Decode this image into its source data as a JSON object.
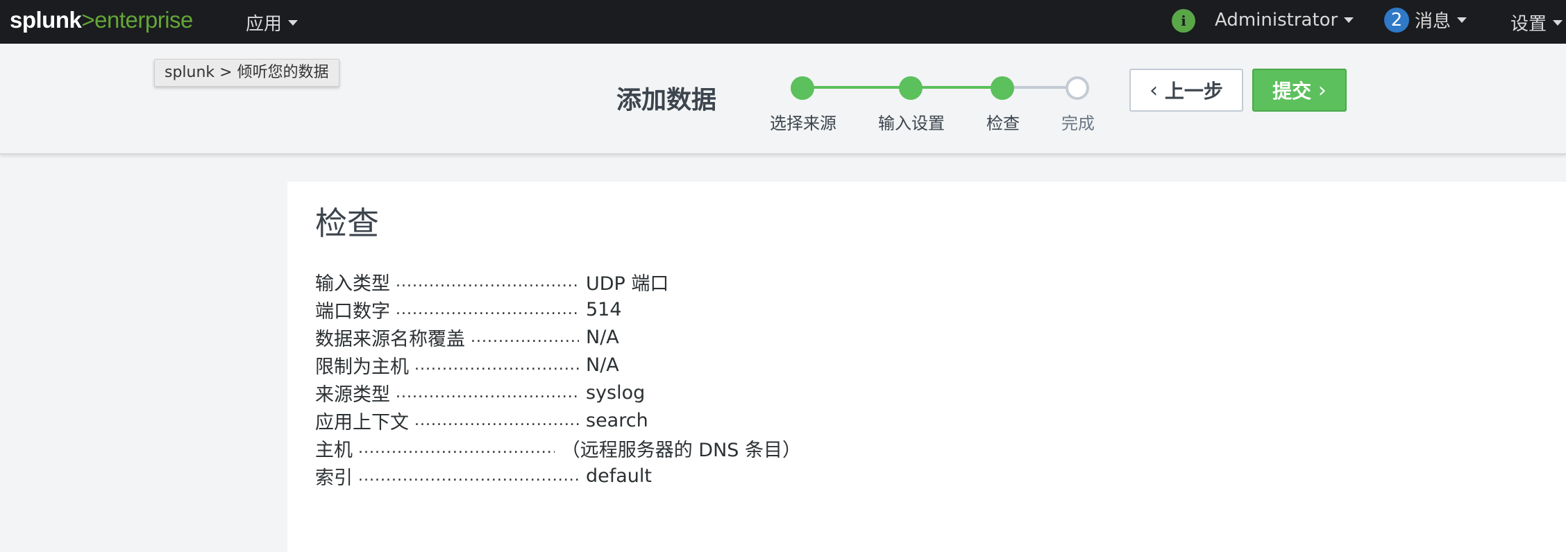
{
  "topbar": {
    "logo_main": "splunk",
    "logo_sep": ">",
    "logo_product": "enterprise",
    "apps_label": "应用",
    "info_icon_text": "i",
    "user_label": "Administrator",
    "messages_count": "2",
    "messages_label": "消息",
    "settings_label": "设置"
  },
  "header": {
    "tooltip": "splunk > 倾听您的数据",
    "title": "添加数据",
    "steps": [
      {
        "label": "选择来源",
        "status": "done"
      },
      {
        "label": "输入设置",
        "status": "done"
      },
      {
        "label": "检查",
        "status": "current"
      },
      {
        "label": "完成",
        "status": "todo"
      }
    ],
    "back_label": "上一步",
    "submit_label": "提交"
  },
  "review": {
    "title": "检查",
    "rows": [
      {
        "key": "输入类型",
        "value": "UDP 端口"
      },
      {
        "key": "端口数字",
        "value": "514"
      },
      {
        "key": "数据来源名称覆盖",
        "value": "N/A"
      },
      {
        "key": "限制为主机",
        "value": "N/A"
      },
      {
        "key": "来源类型",
        "value": "syslog"
      },
      {
        "key": "应用上下文",
        "value": "search"
      },
      {
        "key": "主机",
        "value": "（远程服务器的 DNS 条目）"
      },
      {
        "key": "索引",
        "value": "default"
      }
    ]
  },
  "colors": {
    "topbar_bg": "#1a1c20",
    "brand_green": "#65a637",
    "step_green": "#5cc05c",
    "message_blue": "#2f79c7"
  }
}
